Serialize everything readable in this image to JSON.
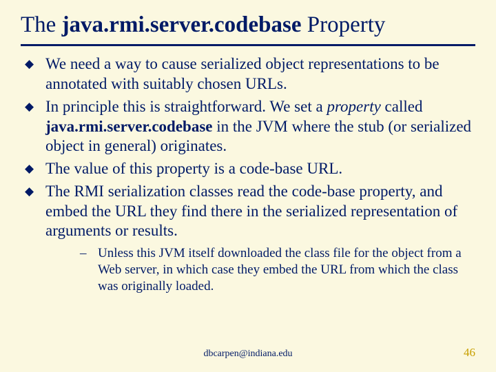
{
  "title": {
    "pre": "The ",
    "mono": "java.rmi.server.codebase",
    "post": " Property"
  },
  "bullets": [
    {
      "type": "plain",
      "text": "We need a way to cause serialized object representations to be annotated with suitably chosen URLs."
    },
    {
      "type": "b2",
      "t1": "In principle this is straightforward.  We set a ",
      "em": "property",
      "t2": " called ",
      "mono": "java.rmi.server.codebase",
      "t3": " in the JVM where the  stub (or serialized object in general) originates."
    },
    {
      "type": "plain",
      "text": "The value of this property is a code-base URL."
    },
    {
      "type": "plain",
      "text": "The RMI serialization classes read the code-base property, and embed the URL they find there in the serialized representation of arguments or results."
    }
  ],
  "subbullet": "Unless this JVM itself downloaded the class file for the object from a Web server, in which case they embed the URL from which the class was originally loaded.",
  "footer": {
    "email": "dbcarpen@indiana.edu",
    "page": "46"
  },
  "chart_data": null
}
